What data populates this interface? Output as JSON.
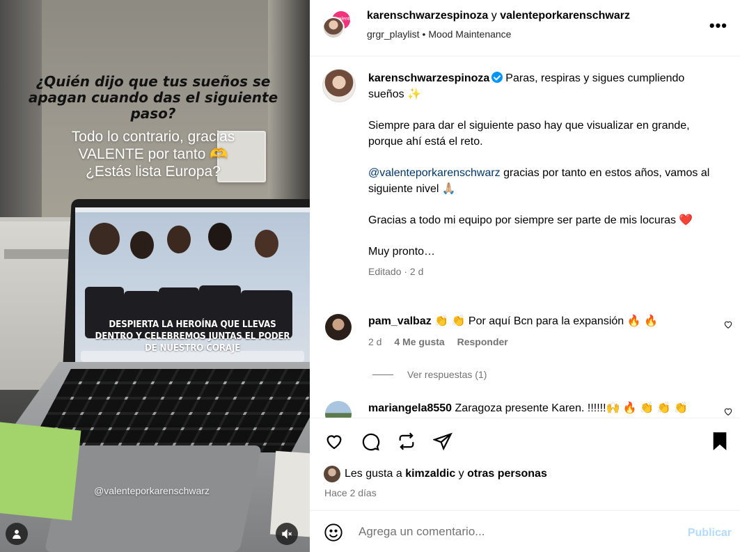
{
  "media": {
    "overlay_title": "¿Quién dijo que tus sueños se apagan cuando das el siguiente paso?",
    "overlay_sub_line1": "Todo lo contrario, gracias",
    "overlay_sub_line2": "VALENTE por tanto 🫶",
    "overlay_sub_line3": "¿Estás lista Europa?",
    "screen_banner": "DESPIERTA LA HEROÍNA QUE LLEVAS DENTRO Y CELEBREMOS JUNTAS EL PODER DE NUESTRO CORAJE",
    "watermark": "@valenteporkarenschwarz",
    "user_tag_icon": "user-icon",
    "mute_icon": "speaker-muted-icon"
  },
  "header": {
    "author": "karenschwarzespinoza",
    "connector": "y",
    "collaborator": "valenteporkarenschwarz",
    "audio_artist": "grgr_playlist",
    "audio_track": "Mood Maintenance",
    "more_icon": "more-options-icon"
  },
  "caption": {
    "username": "karenschwarzespinoza",
    "p1_text": "Paras, respiras y sigues cumpliendo sueños ✨",
    "p2": "Siempre para dar el siguiente paso hay que visualizar en grande, porque ahí está el reto.",
    "p3_mention": "@valenteporkarenschwarz",
    "p3_text": " gracias por tanto en estos años, vamos al siguiente nivel 🙏🏼",
    "p4": "Gracias a todo mi equipo por siempre ser parte de mis locuras ❤️",
    "p5": "Muy pronto…",
    "meta": "Editado · 2 d"
  },
  "comments": [
    {
      "username": "pam_valbaz",
      "text": "👏 👏 Por aquí Bcn para la expansión 🔥 🔥",
      "time": "2 d",
      "likes": "4 Me gusta",
      "reply": "Responder",
      "view_replies": "Ver respuestas (1)"
    },
    {
      "username": "mariangela8550",
      "text": "Zaragoza presente Karen. !!!!!!🙌 🔥 👏 👏 👏"
    }
  ],
  "actions": {
    "like_icon": "heart-icon",
    "comment_icon": "comment-icon",
    "share_icon": "repost-icon",
    "send_icon": "send-icon",
    "save_icon": "bookmark-icon"
  },
  "likes": {
    "prefix": "Les gusta a",
    "user": "kimzaldic",
    "connector": "y",
    "others": "otras personas"
  },
  "timestamp": "Hace 2 días",
  "add_comment": {
    "placeholder": "Agrega un comentario...",
    "post_label": "Publicar"
  }
}
